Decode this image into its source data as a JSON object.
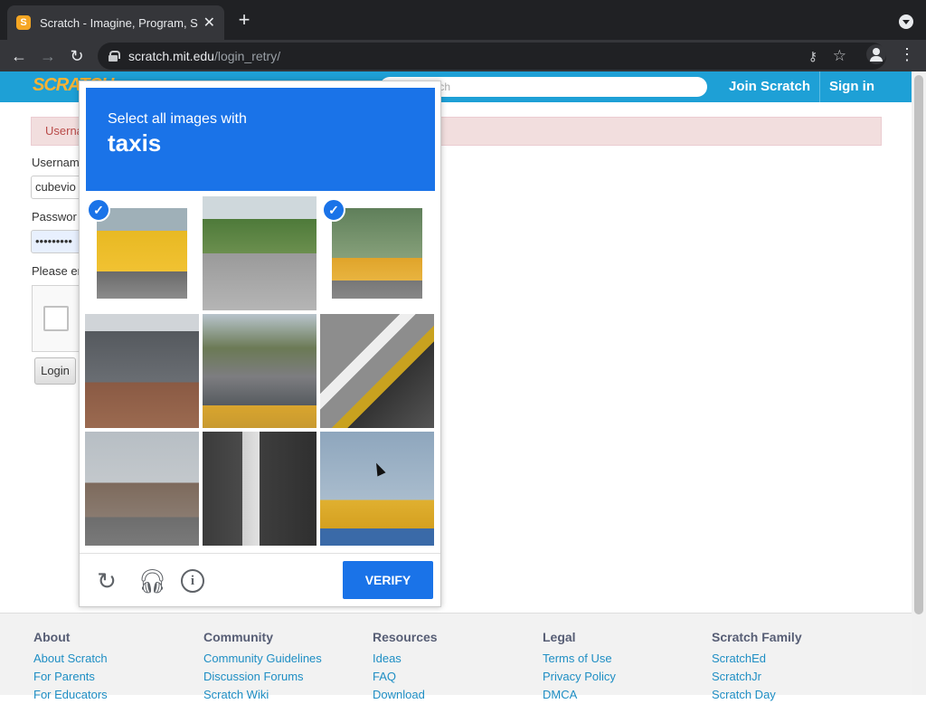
{
  "browser": {
    "tab_title": "Scratch - Imagine, Program, Sh",
    "url_host": "scratch.mit.edu",
    "url_path": "/login_retry/"
  },
  "scratch_nav": {
    "logo": "SCRATCH",
    "search_placeholder": "Search",
    "join": "Join Scratch",
    "sign_in": "Sign in"
  },
  "login_form": {
    "error_text": "Userna",
    "username_label": "Usernam",
    "username_value": "cubevio",
    "password_label": "Passwor",
    "password_value": "•••••••••",
    "captcha_prompt": "Please en",
    "login_button": "Login"
  },
  "captcha": {
    "subtitle": "Select all images with",
    "target": "taxis",
    "verify": "VERIFY",
    "tiles": [
      {
        "desc": "taxi-front",
        "selected": true
      },
      {
        "desc": "road-intersection",
        "selected": false
      },
      {
        "desc": "taxi-street",
        "selected": true
      },
      {
        "desc": "house-roof",
        "selected": false
      },
      {
        "desc": "traffic-street",
        "selected": false
      },
      {
        "desc": "road-markings",
        "selected": false
      },
      {
        "desc": "city-street",
        "selected": false
      },
      {
        "desc": "bridge-pillar",
        "selected": false
      },
      {
        "desc": "storefront-sign",
        "selected": false
      }
    ]
  },
  "footer": {
    "columns": [
      {
        "heading": "About",
        "links": [
          "About Scratch",
          "For Parents",
          "For Educators"
        ]
      },
      {
        "heading": "Community",
        "links": [
          "Community Guidelines",
          "Discussion Forums",
          "Scratch Wiki"
        ]
      },
      {
        "heading": "Resources",
        "links": [
          "Ideas",
          "FAQ",
          "Download"
        ]
      },
      {
        "heading": "Legal",
        "links": [
          "Terms of Use",
          "Privacy Policy",
          "DMCA"
        ]
      },
      {
        "heading": "Scratch Family",
        "links": [
          "ScratchEd",
          "ScratchJr",
          "Scratch Day"
        ]
      }
    ]
  },
  "colors": {
    "accent": "#1a73e8",
    "scratch_blue": "#1ea0d6"
  }
}
